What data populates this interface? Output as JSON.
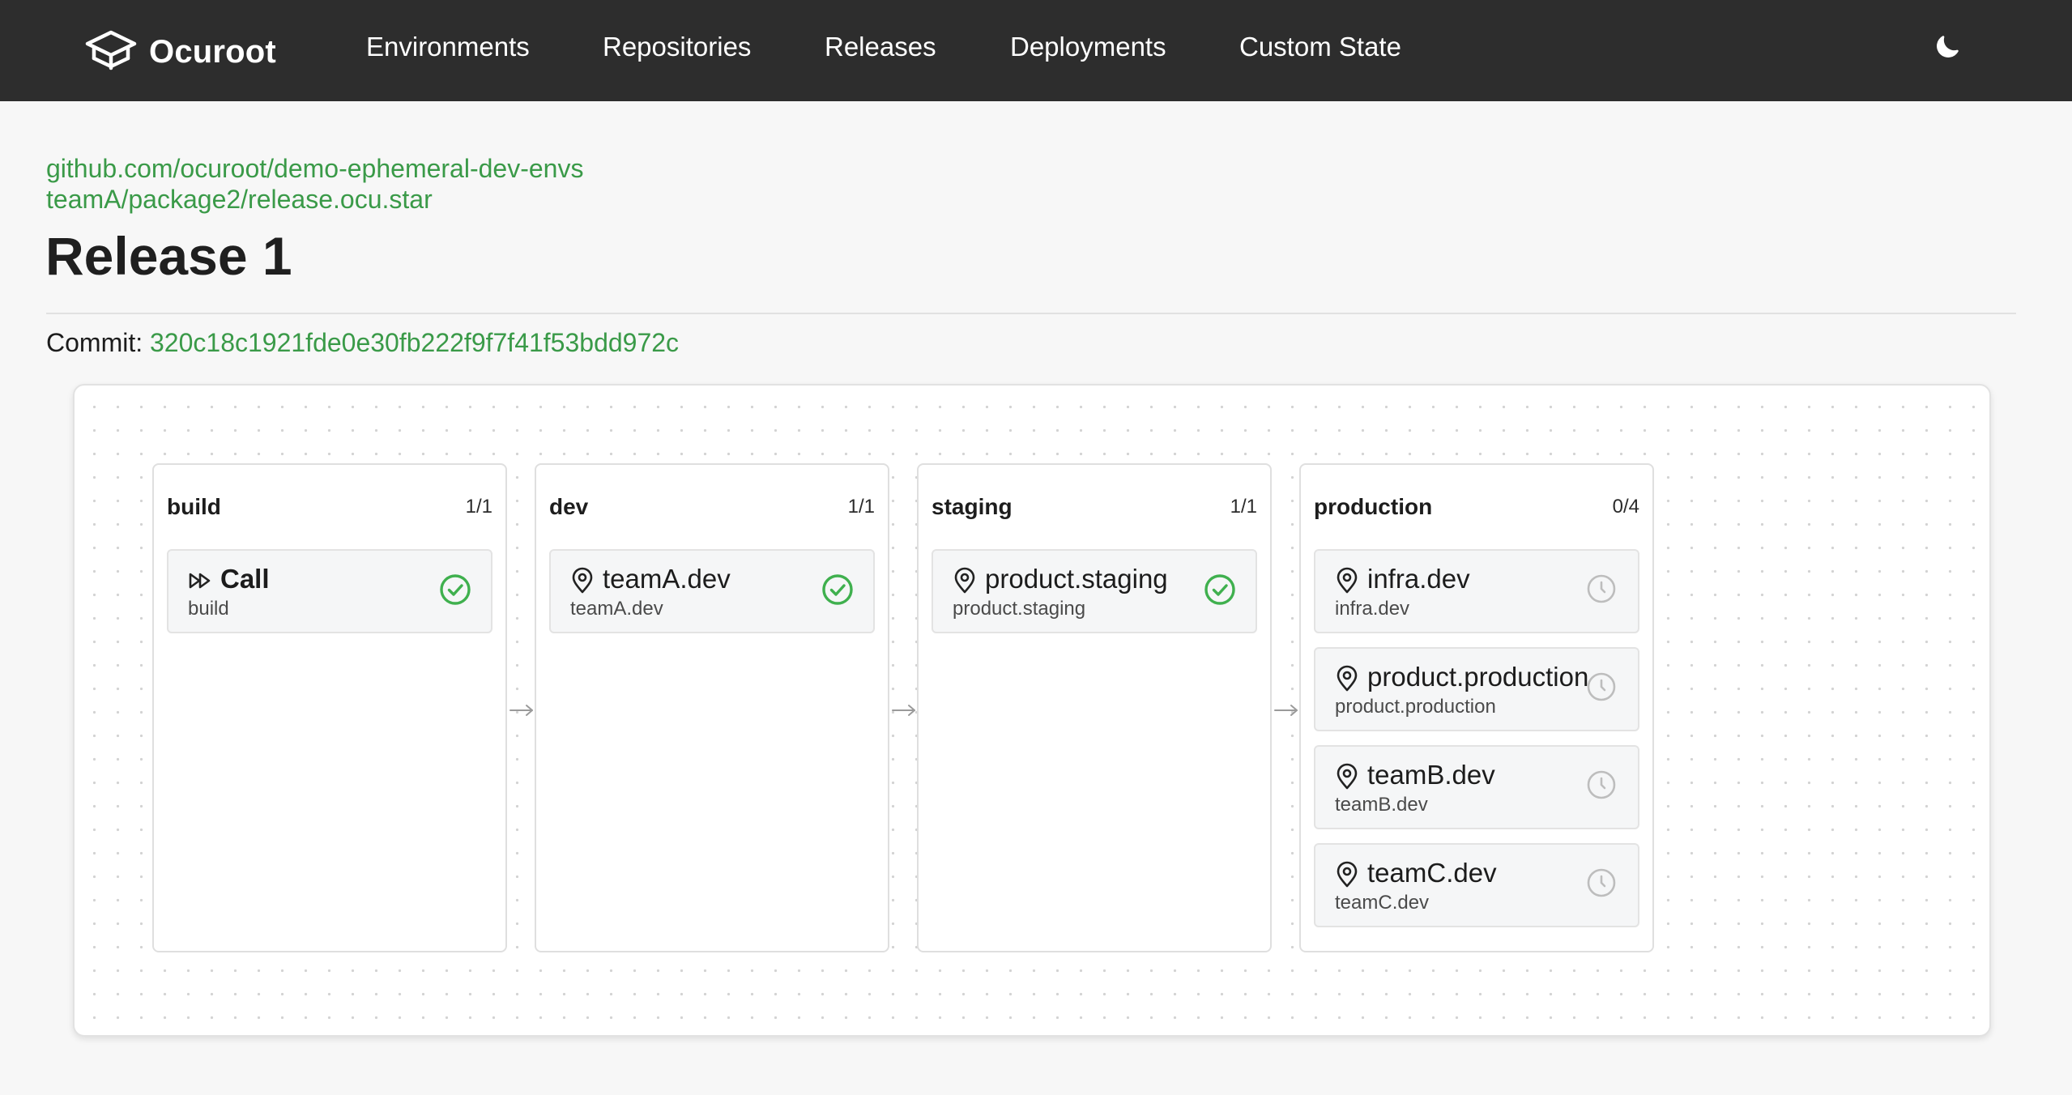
{
  "nav": {
    "brand": "Ocuroot",
    "brand_icon": "ocuroot-logo-icon",
    "links": [
      "Environments",
      "Repositories",
      "Releases",
      "Deployments",
      "Custom State"
    ],
    "theme_icon": "moon-icon"
  },
  "header": {
    "repo": "github.com/ocuroot/demo-ephemeral-dev-envs",
    "file": "teamA/package2/release.ocu.star",
    "title": "Release 1",
    "commit_label": "Commit: ",
    "commit_hash": "320c18c1921fde0e30fb222f9f7f41f53bdd972c"
  },
  "colors": {
    "accent": "#3a9a48",
    "nav_bg": "#2d2d2d",
    "success": "#3fb04e",
    "pending": "#bdbdbd"
  },
  "pipeline": {
    "stages": [
      {
        "name": "build",
        "count": "1/1",
        "tasks": [
          {
            "title": "Call",
            "subtitle": "build",
            "icon": "fast-forward-icon",
            "status": "success"
          }
        ]
      },
      {
        "name": "dev",
        "count": "1/1",
        "tasks": [
          {
            "title": "teamA.dev",
            "subtitle": "teamA.dev",
            "icon": "location-pin-icon",
            "status": "success"
          }
        ]
      },
      {
        "name": "staging",
        "count": "1/1",
        "tasks": [
          {
            "title": "product.staging",
            "subtitle": "product.staging",
            "icon": "location-pin-icon",
            "status": "success"
          }
        ]
      },
      {
        "name": "production",
        "count": "0/4",
        "tasks": [
          {
            "title": "infra.dev",
            "subtitle": "infra.dev",
            "icon": "location-pin-icon",
            "status": "pending"
          },
          {
            "title": "product.production",
            "subtitle": "product.production",
            "icon": "location-pin-icon",
            "status": "pending"
          },
          {
            "title": "teamB.dev",
            "subtitle": "teamB.dev",
            "icon": "location-pin-icon",
            "status": "pending"
          },
          {
            "title": "teamC.dev",
            "subtitle": "teamC.dev",
            "icon": "location-pin-icon",
            "status": "pending"
          }
        ]
      }
    ]
  }
}
